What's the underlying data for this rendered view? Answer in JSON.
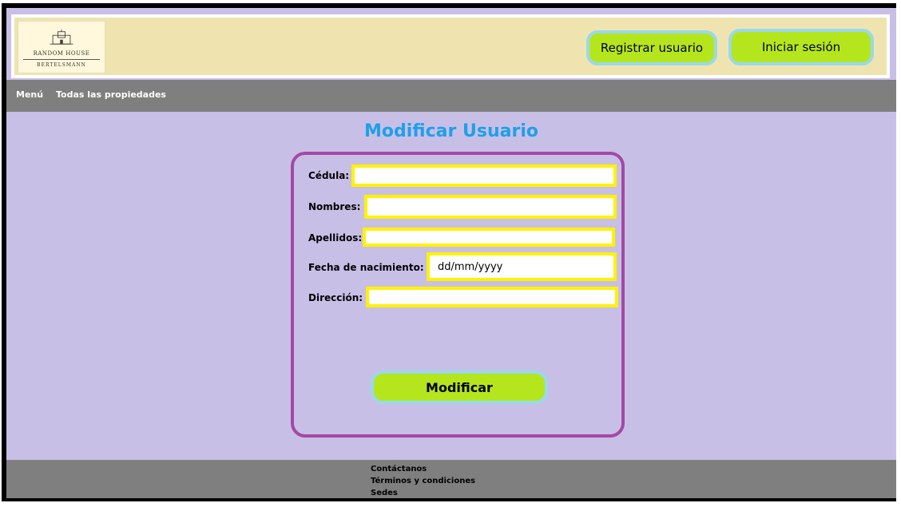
{
  "header": {
    "logo": {
      "line1": "RANDOM HOUSE",
      "line2": "BERTELSMANN"
    },
    "register_label": "Registrar usuario",
    "login_label": "Iniciar sesión"
  },
  "nav": {
    "menu_label": "Menú",
    "all_properties_label": "Todas las propiedades"
  },
  "page": {
    "title": "Modificar Usuario"
  },
  "form": {
    "cedula": {
      "label": "Cédula:",
      "value": ""
    },
    "nombres": {
      "label": "Nombres:",
      "value": ""
    },
    "apellidos": {
      "label": "Apellidos:",
      "value": ""
    },
    "fecha": {
      "label": "Fecha de nacimiento:",
      "placeholder": "dd/mm/yyyy"
    },
    "direccion": {
      "label": "Dirección:",
      "value": ""
    },
    "submit_label": "Modificar"
  },
  "footer": {
    "links": [
      "Contáctanos",
      "Términos y condiciones",
      "Sedes"
    ]
  },
  "colors": {
    "background": "#c8bfe7",
    "header": "#efe4b0",
    "bar": "#7f7f7f",
    "button": "#b5e61d",
    "button_border": "#99d9ea",
    "form_border": "#a349a4",
    "input_border": "#fff200",
    "title": "#1ea0e8"
  },
  "icons": [
    "castle-logo-icon"
  ]
}
